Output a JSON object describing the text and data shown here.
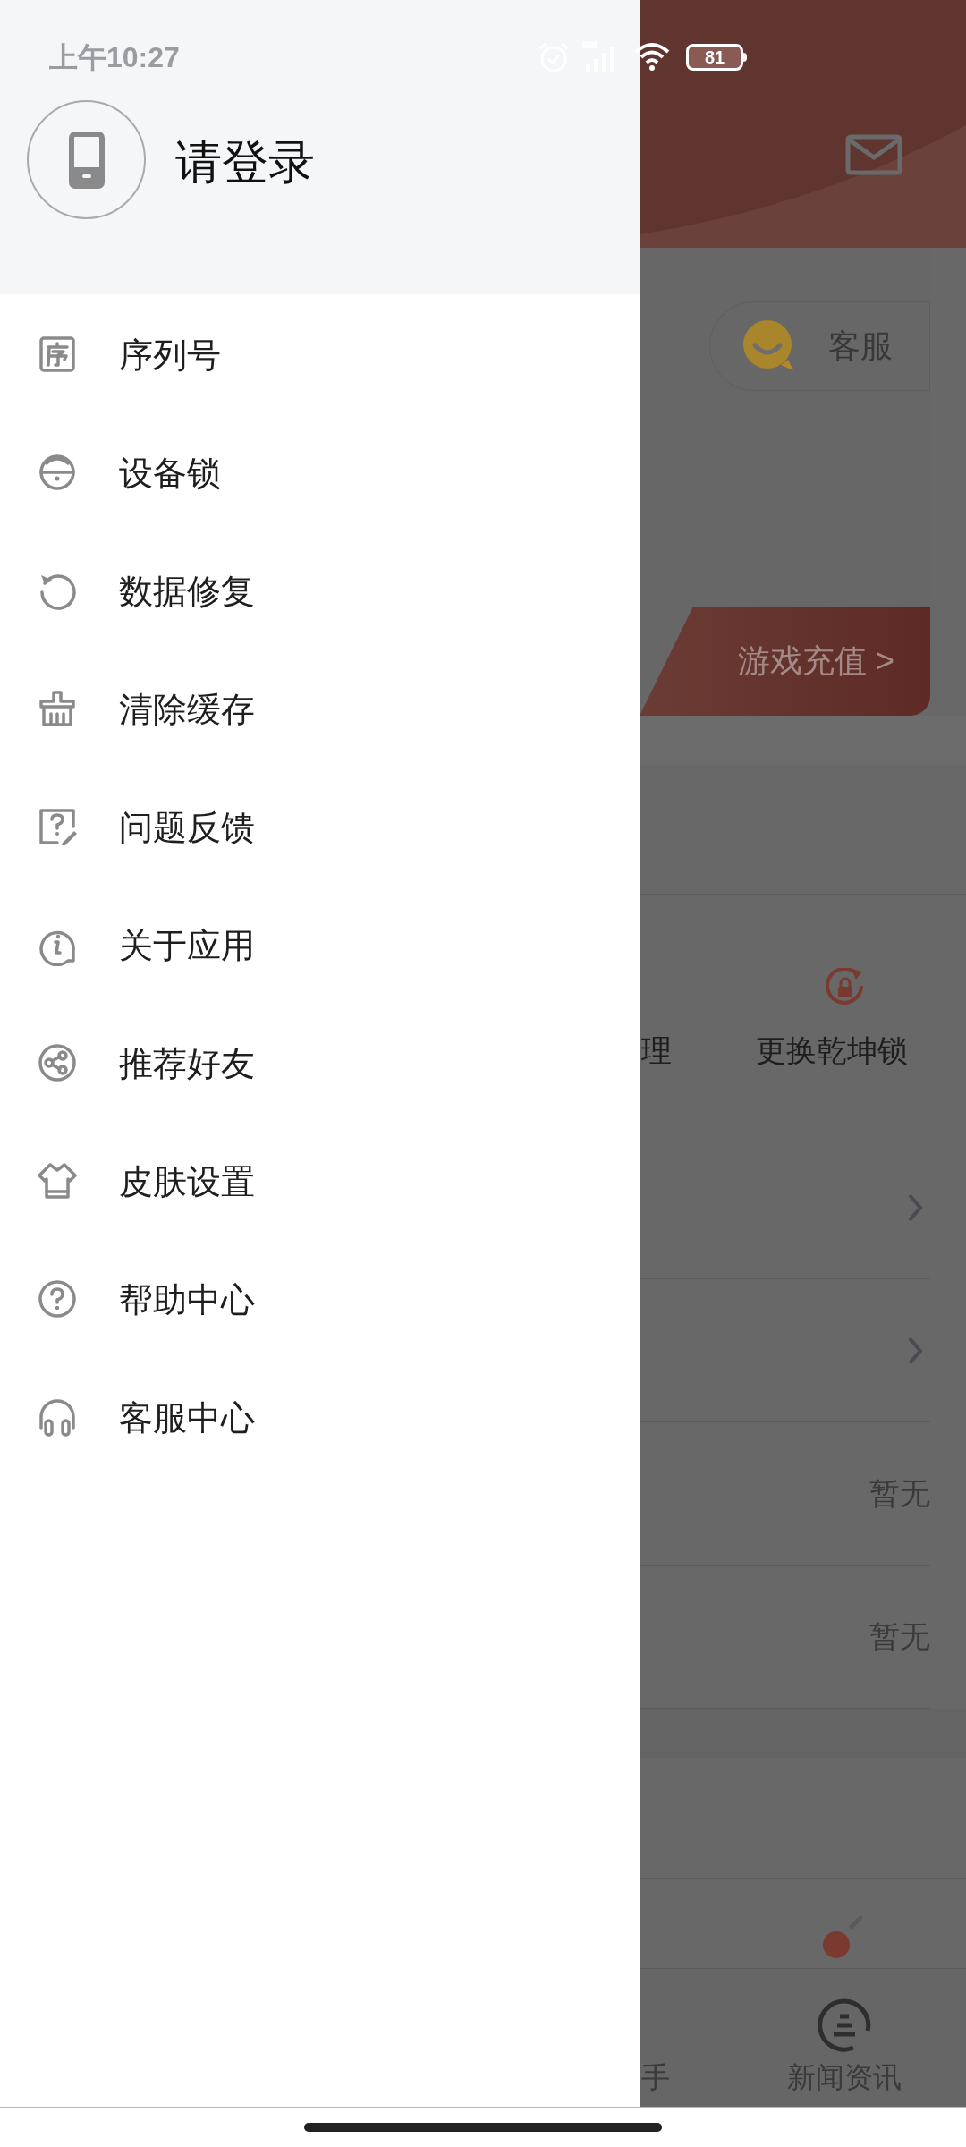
{
  "status_bar": {
    "time": "上午10:27",
    "battery": "81"
  },
  "drawer": {
    "login_prompt": "请登录",
    "menu": [
      {
        "label": "序列号"
      },
      {
        "label": "设备锁"
      },
      {
        "label": "数据修复"
      },
      {
        "label": "清除缓存"
      },
      {
        "label": "问题反馈"
      },
      {
        "label": "关于应用"
      },
      {
        "label": "推荐好友"
      },
      {
        "label": "皮肤设置"
      },
      {
        "label": "帮助中心"
      },
      {
        "label": "客服中心"
      }
    ]
  },
  "background": {
    "service_button": "客服",
    "recharge_link": "游戏充值 >",
    "actions": [
      {
        "label": "理",
        "kind": "cut"
      },
      {
        "label": "更换乾坤锁",
        "kind": "lock"
      }
    ],
    "rows": [
      {
        "kind": "link"
      },
      {
        "kind": "link"
      },
      {
        "kind": "value",
        "value": "暂无"
      },
      {
        "kind": "value",
        "value": "暂无"
      }
    ],
    "nav": [
      {
        "label": "手",
        "kind": "cut"
      },
      {
        "label": "新闻资讯",
        "kind": "news"
      }
    ]
  }
}
